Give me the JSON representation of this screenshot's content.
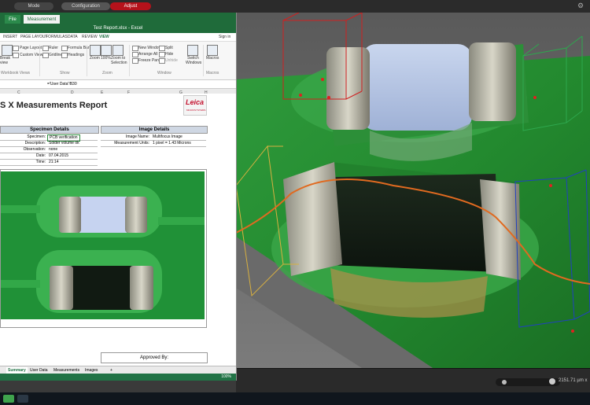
{
  "topbar": {
    "mode": "Mode",
    "configuration": "Configuration",
    "adjust": "Adjust"
  },
  "excel": {
    "file_tab": "File",
    "measurement_tab": "Measurement",
    "title": "Test Report.xlsx - Excel",
    "menu": [
      "INSERT",
      "PAGE LAYOUT",
      "FORMULAS",
      "DATA",
      "REVIEW",
      "VIEW"
    ],
    "sign_in": "Sign in",
    "ribbon": {
      "break": "Break",
      "view": "view",
      "page_layout": "Page Layout",
      "custom_views": "Custom Views",
      "ruler": "Ruler",
      "gridlines": "Gridlines",
      "formula_bar": "Formula Bar",
      "headings": "Headings",
      "zoom": "Zoom",
      "pct100": "100%",
      "zoom_to": "Zoom to",
      "selection": "Selection",
      "new_window": "New Window",
      "arrange_all": "Arrange All",
      "freeze_panes": "Freeze Panes",
      "split": "Split",
      "hide": "Hide",
      "unhide": "Unhide",
      "switch": "Switch",
      "windows": "Windows",
      "macros": "Macros",
      "group_workbook_views": "Workbook Views",
      "group_show": "Show",
      "group_zoom": "Zoom",
      "group_window": "Window",
      "group_macros": "Macros"
    },
    "formula": "='User Data'!B30",
    "columns": [
      "C",
      "D",
      "E",
      "F",
      "G",
      "H"
    ],
    "report_title": "S X Measurements Report",
    "logo_text": "Leica",
    "logo_sub": "MICROSYSTEMS",
    "specimen_header": "Specimen Details",
    "image_header": "Image Details",
    "specimen_rows": [
      {
        "label": "Specimen:",
        "value": "PCB verification"
      },
      {
        "label": "Description:",
        "value": "Solder volume ok"
      },
      {
        "label": "Observation:",
        "value": "none"
      },
      {
        "label": "Date:",
        "value": "07.04.2015"
      },
      {
        "label": "Time:",
        "value": "21:14"
      }
    ],
    "image_rows": [
      {
        "label": "Image Name:",
        "value": "Multifocus Image"
      },
      {
        "label": "Measurement Units:",
        "value": "1 pixel = 1.43 Microns"
      }
    ],
    "approved_by": "Approved By:",
    "sheet_tabs": [
      "Summary",
      "User Data",
      "Measurements",
      "Images"
    ],
    "add_sheet": "+",
    "zoom_level": "100%"
  },
  "viewport": {
    "readout": "2151.71 µm x"
  }
}
